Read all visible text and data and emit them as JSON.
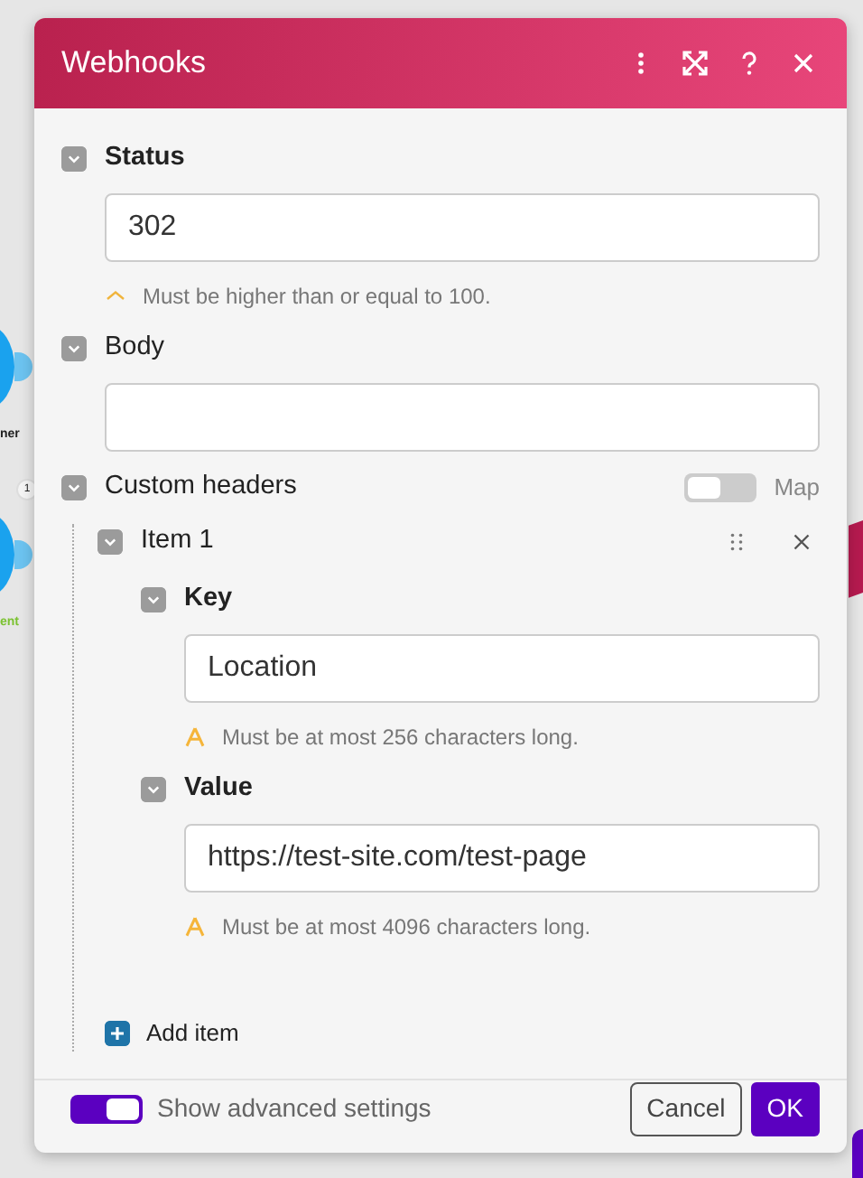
{
  "window": {
    "title": "Webhooks"
  },
  "canvas": {
    "connector_badge": "1",
    "nodes": [
      {
        "label": "ner",
        "color": "#222222"
      },
      {
        "label": "ent",
        "color": "#7cc232"
      }
    ]
  },
  "fields": [
    {
      "kind": "text",
      "label": "Status",
      "bold": true,
      "expanded": true,
      "value": "302",
      "hint": {
        "kind": "caret",
        "text": "Must be higher than or equal to 100."
      }
    },
    {
      "kind": "text",
      "label": "Body",
      "bold": false,
      "expanded": true
    },
    {
      "kind": "array",
      "label": "Custom headers",
      "bold": false,
      "expanded": true,
      "map_toggle": {
        "label": "Map",
        "on": false
      },
      "items": [
        {
          "label": "Item 1",
          "expanded": true,
          "children": [
            {
              "kind": "text",
              "label": "Key",
              "bold": true,
              "expanded": true,
              "value": "Location",
              "hint": {
                "kind": "triangle",
                "text": "Must be at most 256 characters long."
              }
            },
            {
              "kind": "text",
              "label": "Value",
              "bold": true,
              "expanded": true,
              "value": "https://test-site.com/test-page",
              "hint": {
                "kind": "triangle",
                "text": "Must be at most 4096 characters long."
              }
            }
          ]
        }
      ],
      "add_label": "Add item"
    }
  ],
  "footer": {
    "advanced": {
      "label": "Show advanced settings",
      "on": true
    },
    "buttons": [
      {
        "label": "Cancel",
        "kind": "secondary"
      },
      {
        "label": "OK",
        "kind": "primary"
      }
    ]
  }
}
